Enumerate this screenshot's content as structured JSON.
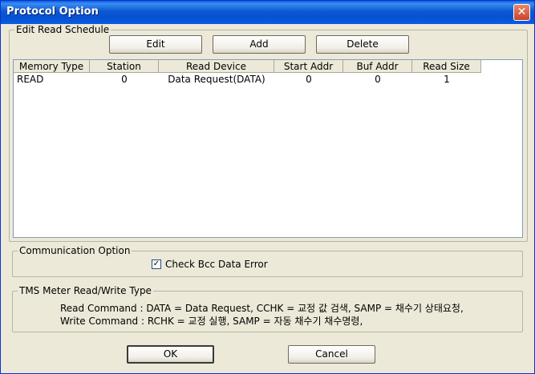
{
  "window": {
    "title": "Protocol Option",
    "close_glyph": "✕"
  },
  "edit_group": {
    "label": "Edit Read Schedule",
    "buttons": {
      "edit": "Edit",
      "add": "Add",
      "delete": "Delete"
    }
  },
  "table": {
    "headers": [
      "Memory Type",
      "Station",
      "Read Device",
      "Start Addr",
      "Buf Addr",
      "Read Size"
    ],
    "rows": [
      [
        "READ",
        "0",
        "Data Request(DATA)",
        "0",
        "0",
        "1"
      ]
    ]
  },
  "comm_group": {
    "label": "Communication Option",
    "checkbox_label": "Check Bcc Data Error",
    "checked_glyph": "✓"
  },
  "tms_group": {
    "label": "TMS Meter Read/Write Type",
    "read_line": "Read Command : DATA = Data Request, CCHK = 교정 값 검색, SAMP = 채수기 상태요청,",
    "write_line": "Write Command : RCHK = 교정 실행, SAMP = 자동 채수기 채수명령,"
  },
  "footer": {
    "ok": "OK",
    "cancel": "Cancel"
  },
  "icons": {
    "close": "close-icon",
    "check": "check-icon"
  }
}
